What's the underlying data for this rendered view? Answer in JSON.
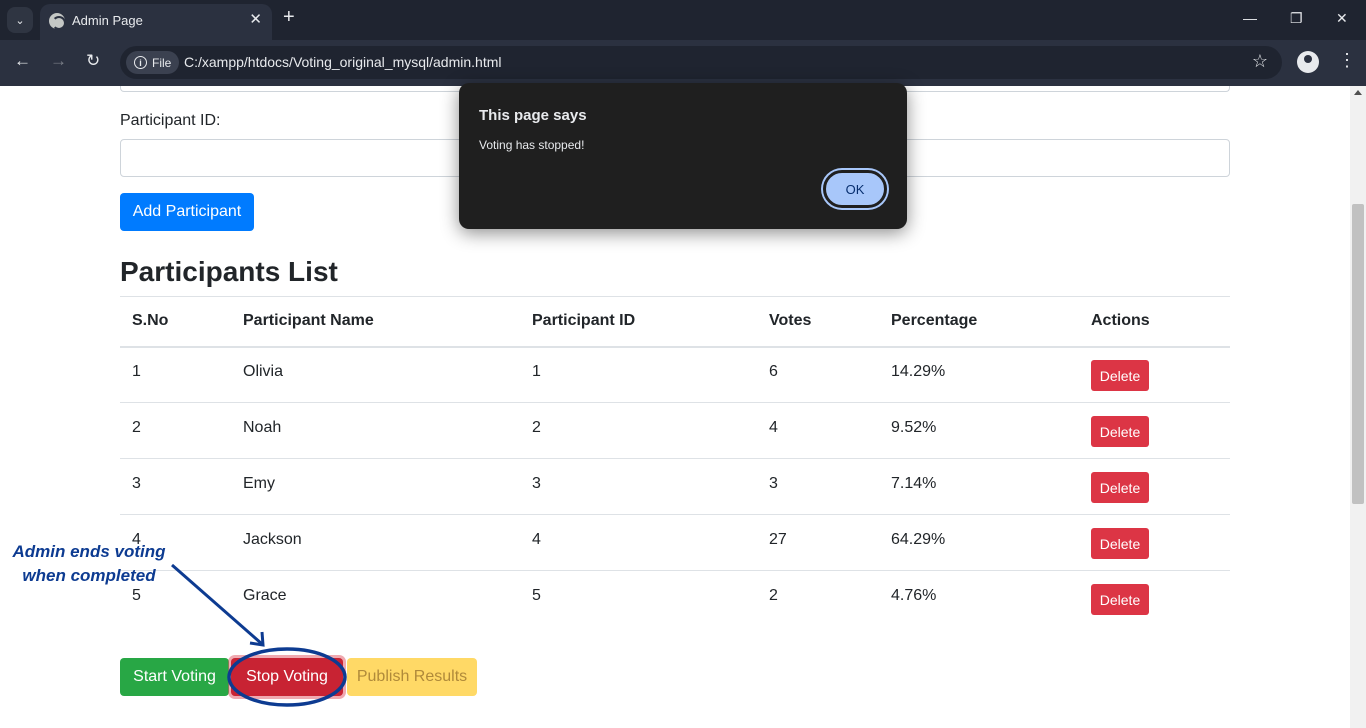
{
  "browser": {
    "tab_title": "Admin Page",
    "chip_label": "File",
    "url": "C:/xampp/htdocs/Voting_original_mysql/admin.html"
  },
  "form": {
    "participant_id_label": "Participant ID:",
    "participant_id_value": "",
    "add_button": "Add Participant"
  },
  "list": {
    "heading": "Participants List",
    "columns": [
      "S.No",
      "Participant Name",
      "Participant ID",
      "Votes",
      "Percentage",
      "Actions"
    ],
    "rows": [
      {
        "sno": "1",
        "name": "Olivia",
        "pid": "1",
        "votes": "6",
        "pct": "14.29%",
        "action": "Delete"
      },
      {
        "sno": "2",
        "name": "Noah",
        "pid": "2",
        "votes": "4",
        "pct": "9.52%",
        "action": "Delete"
      },
      {
        "sno": "3",
        "name": "Emy",
        "pid": "3",
        "votes": "3",
        "pct": "7.14%",
        "action": "Delete"
      },
      {
        "sno": "4",
        "name": "Jackson",
        "pid": "4",
        "votes": "27",
        "pct": "64.29%",
        "action": "Delete"
      },
      {
        "sno": "5",
        "name": "Grace",
        "pid": "5",
        "votes": "2",
        "pct": "4.76%",
        "action": "Delete"
      }
    ]
  },
  "actions": {
    "start": "Start Voting",
    "stop": "Stop Voting",
    "publish": "Publish Results"
  },
  "annotation": {
    "line1": "Admin ends voting",
    "line2": "when completed"
  },
  "dialog": {
    "title": "This page says",
    "message": "Voting has stopped!",
    "ok": "OK"
  },
  "colors": {
    "primary": "#007bff",
    "success": "#28a745",
    "danger": "#dc3545",
    "warning": "#ffd966",
    "annotation": "#0d3b91"
  }
}
